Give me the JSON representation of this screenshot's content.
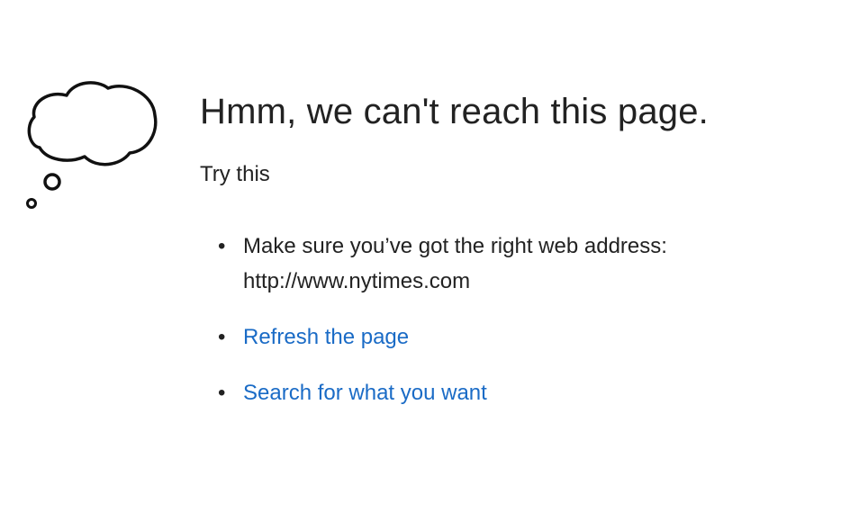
{
  "error": {
    "title": "Hmm, we can't reach this page.",
    "subtitle": "Try this",
    "suggestions": {
      "address_line1": "Make sure you’ve got the right web address:",
      "address_url": "http://www.nytimes.com",
      "refresh_link": "Refresh the page",
      "search_link": "Search for what you want"
    },
    "bullet": "•"
  },
  "icon": "thought-cloud-icon",
  "colors": {
    "text": "#222222",
    "link": "#1a6bc6",
    "background": "#ffffff"
  }
}
